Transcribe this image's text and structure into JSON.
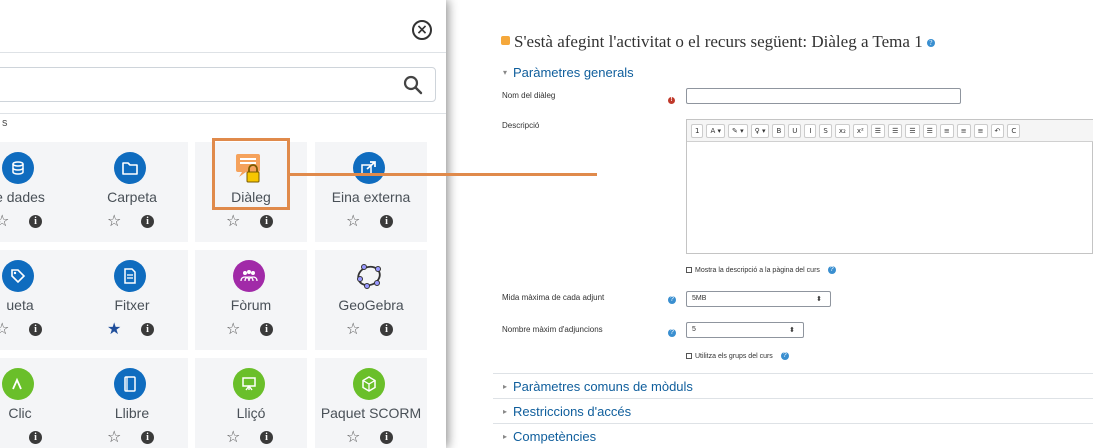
{
  "chooser": {
    "close_symbol": "×",
    "search": {
      "placeholder": "",
      "value": ""
    },
    "section_cut_label": "s",
    "tiles": [
      {
        "name": "e dades",
        "icon": "database-icon",
        "favourite": false
      },
      {
        "name": "Carpeta",
        "icon": "folder-icon",
        "favourite": false
      },
      {
        "name": "Diàleg",
        "icon": "dialog-lock-icon",
        "favourite": false
      },
      {
        "name": "Eina externa",
        "icon": "external-tool-icon",
        "favourite": false
      },
      {
        "name": "ueta",
        "icon": "tag-icon",
        "favourite": false
      },
      {
        "name": "Fitxer",
        "icon": "file-icon",
        "favourite": true
      },
      {
        "name": "Fòrum",
        "icon": "forum-icon",
        "favourite": false
      },
      {
        "name": "GeoGebra",
        "icon": "geogebra-icon",
        "favourite": false
      },
      {
        "name": "Clic",
        "icon": "clic-icon",
        "favourite": false
      },
      {
        "name": "Llibre",
        "icon": "book-icon",
        "favourite": false
      },
      {
        "name": "Lliçó",
        "icon": "lesson-icon",
        "favourite": false
      },
      {
        "name": "Paquet SCORM",
        "icon": "scorm-icon",
        "favourite": false
      }
    ],
    "star_empty": "☆",
    "star_filled": "★",
    "info_symbol": "i"
  },
  "form": {
    "heading": "S'està afegint l'activitat o el recurs següent: Diàleg a Tema 1",
    "general_section": "Paràmetres generals",
    "name_label": "Nom del diàleg",
    "name_value": "",
    "description_label": "Descripció",
    "toolbar_buttons": [
      "1",
      "A ▾",
      "✎ ▾",
      "♀ ▾",
      "B",
      "U",
      "I",
      "S",
      "x₂",
      "x²",
      "☰",
      "☰",
      "☰",
      "☰",
      "≡",
      "≡",
      "≡",
      "↶",
      "C"
    ],
    "show_description_label": "Mostra la descripció a la pàgina del curs",
    "max_size_label": "Mida màxima de cada adjunt",
    "max_size_value": "5MB",
    "max_attachments_label": "Nombre màxim d'adjuncions",
    "max_attachments_value": "5",
    "use_groups_label": "Utilitza els grups del curs",
    "collapsed_sections": [
      "Paràmetres comuns de mòduls",
      "Restriccions d'accés",
      "Competències"
    ],
    "required_symbol": "!",
    "help_symbol": "?"
  },
  "colors": {
    "brand_blue": "#0f6cbf",
    "highlight_orange": "#e08a4b",
    "tile_background": "#f4f5f7"
  }
}
